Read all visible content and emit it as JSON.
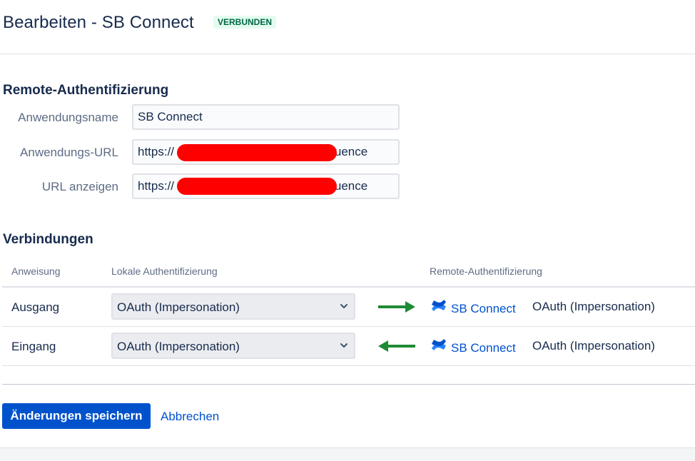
{
  "header": {
    "title": "Bearbeiten - SB Connect",
    "status": "VERBUNDEN"
  },
  "remote_auth": {
    "heading": "Remote-Authentifizierung",
    "fields": [
      {
        "label": "Anwendungsname",
        "value": "SB Connect"
      },
      {
        "label": "Anwendungs-URL",
        "value": "https://                                       /confluence"
      },
      {
        "label": "URL anzeigen",
        "value": "https://                                       /confluence"
      }
    ]
  },
  "connections": {
    "heading": "Verbindungen",
    "columns": {
      "direction": "Anweisung",
      "local_auth": "Lokale Authentifizierung",
      "remote_auth": "Remote-Authentifizierung"
    },
    "rows": [
      {
        "direction": "Ausgang",
        "local_auth": "OAuth (Impersonation)",
        "arrow": "right",
        "app_name": "SB Connect",
        "remote_auth": "OAuth (Impersonation)"
      },
      {
        "direction": "Eingang",
        "local_auth": "OAuth (Impersonation)",
        "arrow": "left",
        "app_name": "SB Connect",
        "remote_auth": "OAuth (Impersonation)"
      }
    ]
  },
  "actions": {
    "save_label": "Änderungen speichern",
    "cancel_label": "Abbrechen"
  },
  "colors": {
    "primary": "#0052cc",
    "arrow_green": "#1f8a34",
    "status_bg": "#e3fcef",
    "status_text": "#006644",
    "redaction": "#ff0000"
  },
  "icons": {
    "app": "confluence-logo-icon",
    "arrow_out": "arrow-right-icon",
    "arrow_in": "arrow-left-icon",
    "select": "chevron-down-icon"
  }
}
